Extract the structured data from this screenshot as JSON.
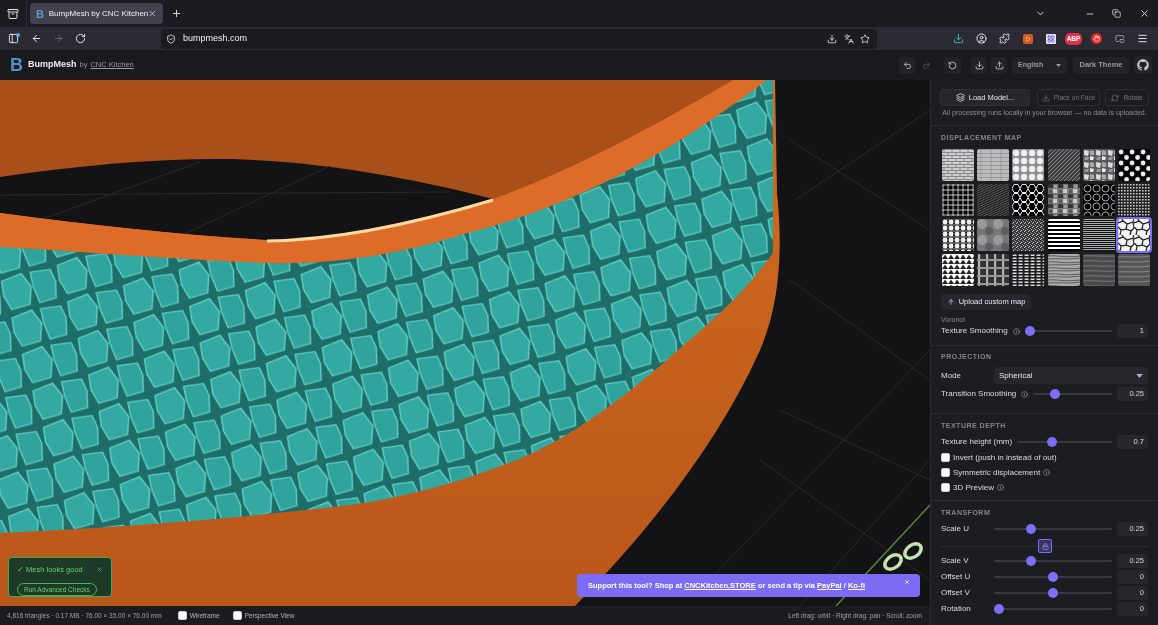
{
  "browser": {
    "tab": {
      "favicon": "B",
      "title": "BumpMesh by CNC Kitchen",
      "selected": true
    },
    "nav": [
      {
        "kind": "back",
        "disabled": false
      },
      {
        "kind": "forward",
        "disabled": true
      },
      {
        "kind": "reload",
        "disabled": false
      }
    ],
    "address": "bumpmesh.com",
    "adblock_label": "ABP"
  },
  "header": {
    "logo": "B",
    "title": "BumpMesh",
    "by": "by",
    "author_link": "CNC Kitchen",
    "history": [
      {
        "kind": "undo",
        "disabled": false
      },
      {
        "kind": "redo",
        "disabled": true
      }
    ],
    "language": "English",
    "theme_button": "Dark Theme"
  },
  "viewport": {
    "toast": {
      "message": "✓ Mesh looks good",
      "button": "Run Advanced Checks"
    },
    "banner": {
      "segments": [
        {
          "kind": "text",
          "text": "Support this tool? Shop at "
        },
        {
          "kind": "link",
          "text": "CNCKitchen.STORE"
        },
        {
          "kind": "text",
          "text": " or send a tip via "
        },
        {
          "kind": "link",
          "text": "PayPal"
        },
        {
          "kind": "text",
          "text": " / "
        },
        {
          "kind": "link",
          "text": "Ko-fi"
        }
      ]
    }
  },
  "status_bar": {
    "stats": "4,816 triangles · 0.17 MB · 76.00 × 35.00 × 76.00 mm",
    "toggles": [
      {
        "label": "Wireframe",
        "checked": false
      },
      {
        "label": "Perspective View",
        "checked": false
      }
    ],
    "hint": "Left drag: orbit · Right drag: pan · Scroll: zoom"
  },
  "panel": {
    "actions": [
      {
        "kind": "load",
        "label": "Load Model...",
        "disabled": false
      },
      {
        "kind": "place",
        "label": "Place on Face",
        "disabled": true
      },
      {
        "kind": "rotate",
        "label": "Rotate",
        "disabled": true
      }
    ],
    "note": "All processing runs locally in your browser — no data is uploaded.",
    "displacement": {
      "heading": "DISPLACEMENT MAP",
      "maps": [
        {
          "selected": false
        },
        {
          "selected": false
        },
        {
          "selected": false
        },
        {
          "selected": false
        },
        {
          "selected": false
        },
        {
          "selected": false
        },
        {
          "selected": false
        },
        {
          "selected": false
        },
        {
          "selected": false
        },
        {
          "selected": false
        },
        {
          "selected": false
        },
        {
          "selected": false
        },
        {
          "selected": false
        },
        {
          "selected": false
        },
        {
          "selected": false
        },
        {
          "selected": false
        },
        {
          "selected": false
        },
        {
          "selected": true
        },
        {
          "selected": false
        },
        {
          "selected": false
        },
        {
          "selected": false
        },
        {
          "selected": false
        },
        {
          "selected": false
        },
        {
          "selected": false
        }
      ],
      "upload_button": "Upload custom map",
      "selected_name": "Voronoi",
      "smoothing": {
        "label": "Texture Smoothing",
        "info": true,
        "level": 0,
        "value": "1"
      }
    },
    "projection": {
      "heading": "PROJECTION",
      "mode": {
        "label": "Mode",
        "value": "Spherical"
      },
      "transition": {
        "label": "Transition Smoothing",
        "info": true,
        "level": 0.25,
        "value": "0.25"
      }
    },
    "depth": {
      "heading": "TEXTURE DEPTH",
      "height": {
        "label": "Texture height (mm)",
        "info": false,
        "level": 0.35,
        "value": "0.7"
      },
      "options": [
        {
          "label": "Invert (push in instead of out)",
          "checked": false,
          "info": false
        },
        {
          "label": "Symmetric displacement",
          "checked": false,
          "info": true
        },
        {
          "label": "3D Preview",
          "checked": false,
          "info": true
        }
      ]
    },
    "transform": {
      "heading": "TRANSFORM",
      "scale": [
        {
          "label": "Scale U",
          "level": 0.3,
          "value": "0.25"
        },
        {
          "label": "Scale V",
          "level": 0.3,
          "value": "0.25"
        }
      ],
      "scale_lock": {
        "locked": true
      },
      "placement": [
        {
          "label": "Offset U",
          "level": 0.5,
          "value": "0"
        },
        {
          "label": "Offset V",
          "level": 0.5,
          "value": "0"
        },
        {
          "label": "Rotation",
          "level": 0,
          "value": "0"
        }
      ]
    }
  }
}
